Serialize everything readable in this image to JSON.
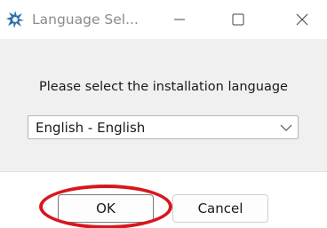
{
  "window": {
    "title": "Language Sel...",
    "icon": "installer-app-icon"
  },
  "titlebar": {
    "minimize_icon": "minimize-icon",
    "maximize_icon": "maximize-icon",
    "close_icon": "close-icon"
  },
  "dialog": {
    "prompt": "Please select the installation language",
    "language_select": {
      "value": "English - English"
    }
  },
  "footer": {
    "ok_label": "OK",
    "cancel_label": "Cancel"
  },
  "annotation": {
    "color": "#d6171f",
    "target": "ok-button"
  }
}
